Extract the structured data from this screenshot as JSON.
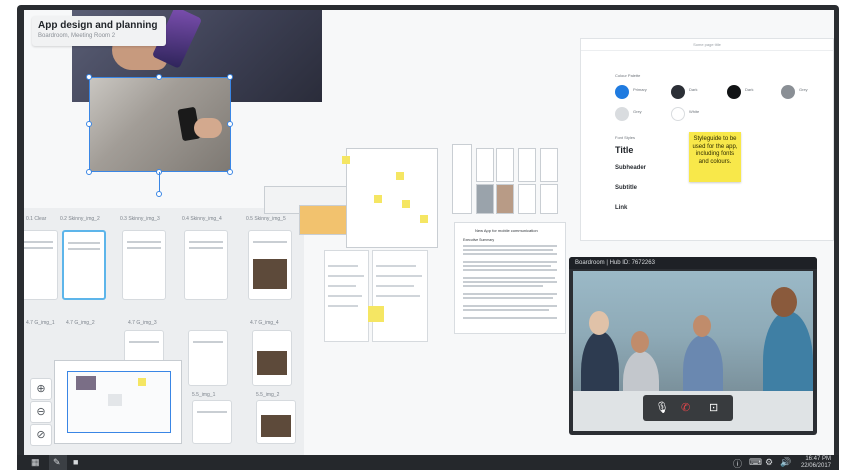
{
  "board": {
    "title": "App design and planning",
    "subtitle": "Boardroom, Meeting Room 2"
  },
  "phones": {
    "row1_labels": [
      "0.1 Clear",
      "0.2 Skinny_img_2",
      "0.3 Skinny_img_3",
      "0.4 Skinny_img_4",
      "0.5 Skinny_img_5"
    ],
    "row2_labels": [
      "4.7 G_img_1",
      "4.7 G_img_2",
      "4.7 G_img_3",
      "4.7 G_img_4"
    ],
    "row3_labels": [
      "5.5_img_1",
      "5.5_img_2"
    ]
  },
  "zoom": {
    "zoom_in": "⊕",
    "zoom_out": "⊖",
    "fit": "⊘"
  },
  "styleguide": {
    "header": "Some page title",
    "colors_label": "Colour Palette",
    "swatches": [
      {
        "name": "Primary",
        "color": "#1f7be0"
      },
      {
        "name": "Dark",
        "color": "#2b2f36"
      },
      {
        "name": "Dark",
        "color": "#111315"
      },
      {
        "name": "Grey",
        "color": "#8a8f95"
      },
      {
        "name": "Grey",
        "color": "#d9dcdf"
      },
      {
        "name": "White",
        "color": "#ffffff"
      }
    ],
    "type_label": "Font Styles",
    "title": "Title",
    "subheader": "Subheader",
    "subtitle": "Subtitle",
    "link": "Link"
  },
  "sticky": {
    "text": "Styleguide to be used for the app, including fonts and colours."
  },
  "document": {
    "title": "New App for mobile communication",
    "section": "Executive Summary"
  },
  "video": {
    "header": "Boardroom | Hub ID: 7672263",
    "mic": "🎙",
    "hangup": "✆",
    "camera": "⊡"
  },
  "taskbar": {
    "apps": "▦",
    "pen": "✎",
    "camera": "■",
    "tray_info": "ⓘ",
    "tray_keyboard": "⌨",
    "tray_settings": "⚙",
    "tray_volume": "🔊",
    "time": "16:47 PM",
    "date": "22/06/2017"
  },
  "colors": {
    "accent": "#3a86e5",
    "sticky": "#f8e84a",
    "taskbar": "#25282c"
  }
}
